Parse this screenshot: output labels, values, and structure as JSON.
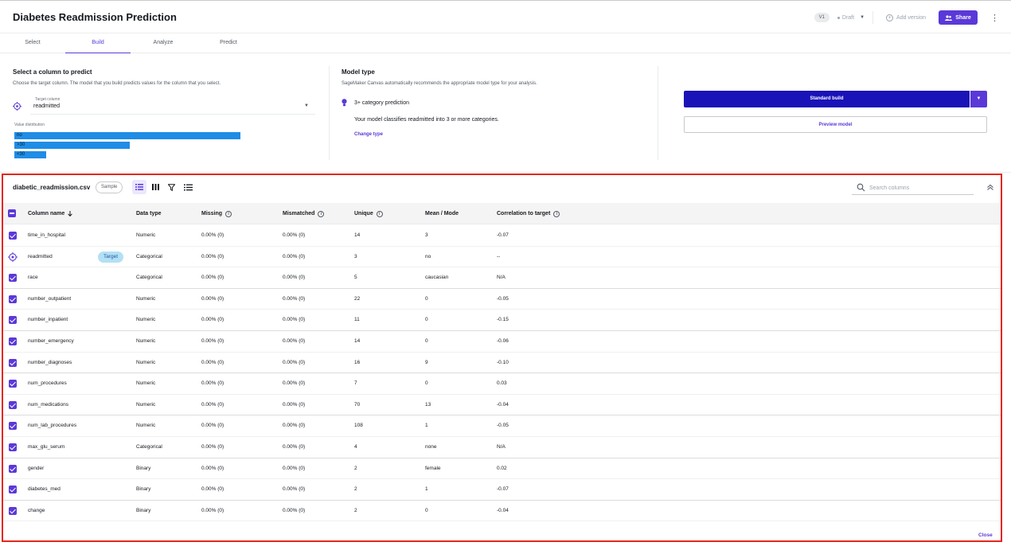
{
  "app": {
    "title": "Diabetes Readmission Prediction",
    "version": "V1",
    "status": "Draft",
    "add_version": "Add version",
    "share": "Share"
  },
  "tabs": [
    {
      "label": "Select",
      "active": false
    },
    {
      "label": "Build",
      "active": true
    },
    {
      "label": "Analyze",
      "active": false
    },
    {
      "label": "Predict",
      "active": false
    }
  ],
  "target": {
    "title": "Select a column to predict",
    "description": "Choose the target column. The model that you build predicts values for the column that you select.",
    "field_label": "Target column",
    "value": "readmitted",
    "distribution_label": "Value distribution",
    "distribution": [
      {
        "label": "no",
        "fraction": 1.0
      },
      {
        "label": ">30",
        "fraction": 0.51
      },
      {
        "label": "<30",
        "fraction": 0.14
      }
    ]
  },
  "model_type": {
    "title": "Model type",
    "description": "SageMaker Canvas automatically recommends the appropriate model type for your analysis.",
    "type": "3+ category prediction",
    "type_description": "Your model classifies readmitted into 3 or more categories.",
    "change_link": "Change type"
  },
  "actions": {
    "standard_build": "Standard build",
    "preview_model": "Preview model"
  },
  "dataset": {
    "file_name": "diabetic_readmission.csv",
    "sample_badge": "Sample",
    "search_placeholder": "Search columns",
    "close": "Close"
  },
  "columns": {
    "column_name": "Column name",
    "data_type": "Data type",
    "missing": "Missing",
    "mismatched": "Mismatched",
    "unique": "Unique",
    "mean_mode": "Mean / Mode",
    "correlation": "Correlation to target"
  },
  "rows": [
    {
      "name": "time_in_hospital",
      "type": "Numeric",
      "missing": "0.00% (0)",
      "mismatched": "0.00% (0)",
      "unique": "14",
      "mean_mode": "3",
      "correlation": "-0.07",
      "target": false
    },
    {
      "name": "readmitted",
      "type": "Categorical",
      "missing": "0.00% (0)",
      "mismatched": "0.00% (0)",
      "unique": "3",
      "mean_mode": "no",
      "correlation": "--",
      "target": true,
      "badge": "Target"
    },
    {
      "name": "race",
      "type": "Categorical",
      "missing": "0.00% (0)",
      "mismatched": "0.00% (0)",
      "unique": "5",
      "mean_mode": "caucasian",
      "correlation": "N/A",
      "target": false
    },
    {
      "name": "number_outpatient",
      "type": "Numeric",
      "missing": "0.00% (0)",
      "mismatched": "0.00% (0)",
      "unique": "22",
      "mean_mode": "0",
      "correlation": "-0.05",
      "target": false
    },
    {
      "name": "number_inpatient",
      "type": "Numeric",
      "missing": "0.00% (0)",
      "mismatched": "0.00% (0)",
      "unique": "11",
      "mean_mode": "0",
      "correlation": "-0.15",
      "target": false
    },
    {
      "name": "number_emergency",
      "type": "Numeric",
      "missing": "0.00% (0)",
      "mismatched": "0.00% (0)",
      "unique": "14",
      "mean_mode": "0",
      "correlation": "-0.06",
      "target": false
    },
    {
      "name": "number_diagnoses",
      "type": "Numeric",
      "missing": "0.00% (0)",
      "mismatched": "0.00% (0)",
      "unique": "16",
      "mean_mode": "9",
      "correlation": "-0.10",
      "target": false
    },
    {
      "name": "num_procedures",
      "type": "Numeric",
      "missing": "0.00% (0)",
      "mismatched": "0.00% (0)",
      "unique": "7",
      "mean_mode": "0",
      "correlation": "0.03",
      "target": false
    },
    {
      "name": "num_medications",
      "type": "Numeric",
      "missing": "0.00% (0)",
      "mismatched": "0.00% (0)",
      "unique": "70",
      "mean_mode": "13",
      "correlation": "-0.04",
      "target": false
    },
    {
      "name": "num_lab_procedures",
      "type": "Numeric",
      "missing": "0.00% (0)",
      "mismatched": "0.00% (0)",
      "unique": "108",
      "mean_mode": "1",
      "correlation": "-0.05",
      "target": false
    },
    {
      "name": "max_glu_serum",
      "type": "Categorical",
      "missing": "0.00% (0)",
      "mismatched": "0.00% (0)",
      "unique": "4",
      "mean_mode": "none",
      "correlation": "N/A",
      "target": false
    },
    {
      "name": "gender",
      "type": "Binary",
      "missing": "0.00% (0)",
      "mismatched": "0.00% (0)",
      "unique": "2",
      "mean_mode": "female",
      "correlation": "0.02",
      "target": false
    },
    {
      "name": "diabetes_med",
      "type": "Binary",
      "missing": "0.00% (0)",
      "mismatched": "0.00% (0)",
      "unique": "2",
      "mean_mode": "1",
      "correlation": "-0.07",
      "target": false
    },
    {
      "name": "change",
      "type": "Binary",
      "missing": "0.00% (0)",
      "mismatched": "0.00% (0)",
      "unique": "2",
      "mean_mode": "0",
      "correlation": "-0.04",
      "target": false
    }
  ],
  "colors": {
    "accent": "#5a39d8",
    "primary_button": "#1a13b8",
    "distribution_bar": "#1f8ce6",
    "highlight_border": "#e5261a",
    "target_badge": "#b4e0f5"
  }
}
